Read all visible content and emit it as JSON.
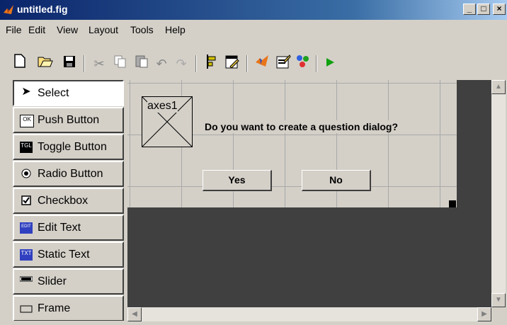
{
  "window": {
    "title": "untitled.fig",
    "controls": {
      "minimize": "_",
      "maximize": "□",
      "close": "×"
    }
  },
  "menu": [
    "File",
    "Edit",
    "View",
    "Layout",
    "Tools",
    "Help"
  ],
  "toolbar": {
    "icons": [
      "new-icon",
      "open-icon",
      "save-icon",
      "cut-icon",
      "copy-icon",
      "paste-icon",
      "undo-icon",
      "redo-icon",
      "align-icon",
      "menu-editor-icon",
      "tab-order-icon",
      "property-inspector-icon",
      "object-browser-icon",
      "run-icon"
    ]
  },
  "palette": {
    "items": [
      {
        "label": "Select",
        "icon": "arrow-icon",
        "selected": true
      },
      {
        "label": "Push Button",
        "icon": "push-button-icon",
        "icon_text": "OK"
      },
      {
        "label": "Toggle Button",
        "icon": "toggle-button-icon",
        "icon_text": "TGL"
      },
      {
        "label": "Radio Button",
        "icon": "radio-button-icon"
      },
      {
        "label": "Checkbox",
        "icon": "checkbox-icon"
      },
      {
        "label": "Edit Text",
        "icon": "edit-text-icon",
        "icon_text": "EDIT"
      },
      {
        "label": "Static Text",
        "icon": "static-text-icon",
        "icon_text": "TXT"
      },
      {
        "label": "Slider",
        "icon": "slider-icon"
      },
      {
        "label": "Frame",
        "icon": "frame-icon"
      }
    ]
  },
  "figure": {
    "axes_label": "axes1",
    "question": "Do you want to create a question dialog?",
    "yes_label": "Yes",
    "no_label": "No"
  },
  "colors": {
    "title_bar": "#0a246a",
    "canvas_bg": "#404040",
    "figure_bg": "#d4d0c8"
  }
}
